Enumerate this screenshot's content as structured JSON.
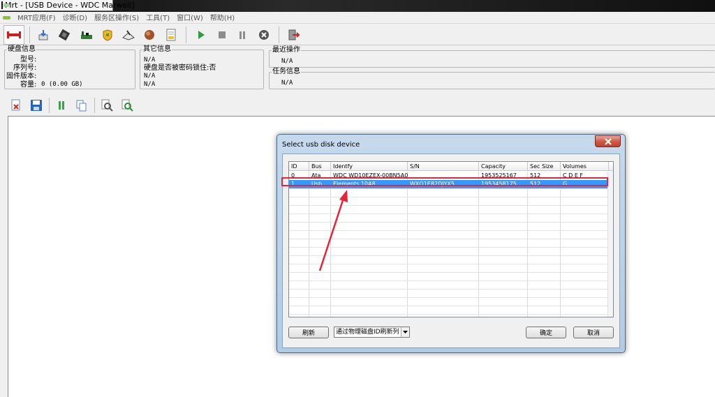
{
  "window": {
    "title": "Mrt - [USB Device - WDC Marwell]"
  },
  "menu": [
    {
      "label": "MRT应用(F)"
    },
    {
      "label": "诊断(D)"
    },
    {
      "label": "服务区操作(S)"
    },
    {
      "label": "工具(T)"
    },
    {
      "label": "窗口(W)"
    },
    {
      "label": "帮助(H)"
    }
  ],
  "toolbar_icons": [
    "connect-icon",
    "download-icon",
    "chip-icon",
    "pcb-icon",
    "shield-icon",
    "scanner-icon",
    "sphere-icon",
    "report-icon",
    "play-icon",
    "stop-icon",
    "pause-icon",
    "cancel-icon",
    "exit-icon"
  ],
  "disk_info": {
    "title": "硬盘信息",
    "model_label": "型号:",
    "serial_label": "序列号:",
    "firmware_label": "固件版本:",
    "capacity_label": "容量:",
    "capacity_value": "0 (0.00 GB)"
  },
  "other_info": {
    "title": "其它信息",
    "line1": "N/A",
    "line2": "硬盘是否被密码锁住:否",
    "line3": "N/A",
    "line4": "N/A"
  },
  "recent_ops": {
    "title": "最近操作",
    "value": "N/A"
  },
  "task_info": {
    "title": "任务信息",
    "value": "N/A"
  },
  "toolbar2_icons": [
    "delete-file-icon",
    "save-icon",
    "pause-icon",
    "copy-icon",
    "search-icon",
    "search-next-icon"
  ],
  "dialog": {
    "title": "Select usb disk device",
    "columns": [
      "ID",
      "Bus",
      "Identfy",
      "S/N",
      "Capacity",
      "Sec Size",
      "Volumes"
    ],
    "rows": [
      {
        "id": "0",
        "bus": "Ata",
        "identify": "WDC WD10EZEX-00BN5A0",
        "sn": "",
        "capacity": "1953525167",
        "sec_size": "512",
        "volumes": "C D E F"
      },
      {
        "id": "1",
        "bus": "Usb",
        "identify": "Elements 10A8",
        "sn": "WXQ1E82DJYX5",
        "capacity": "1953458175",
        "sec_size": "512",
        "volumes": "G"
      }
    ],
    "selected_row": 1,
    "refresh_label": "刷新",
    "mode_select_value": "通过物理磁盘ID刷新列",
    "ok_label": "确定",
    "cancel_label": "取消"
  },
  "colors": {
    "selection": "#3399ff",
    "annotation": "#e8243a",
    "dialog_frame": "#b9d1ea"
  }
}
